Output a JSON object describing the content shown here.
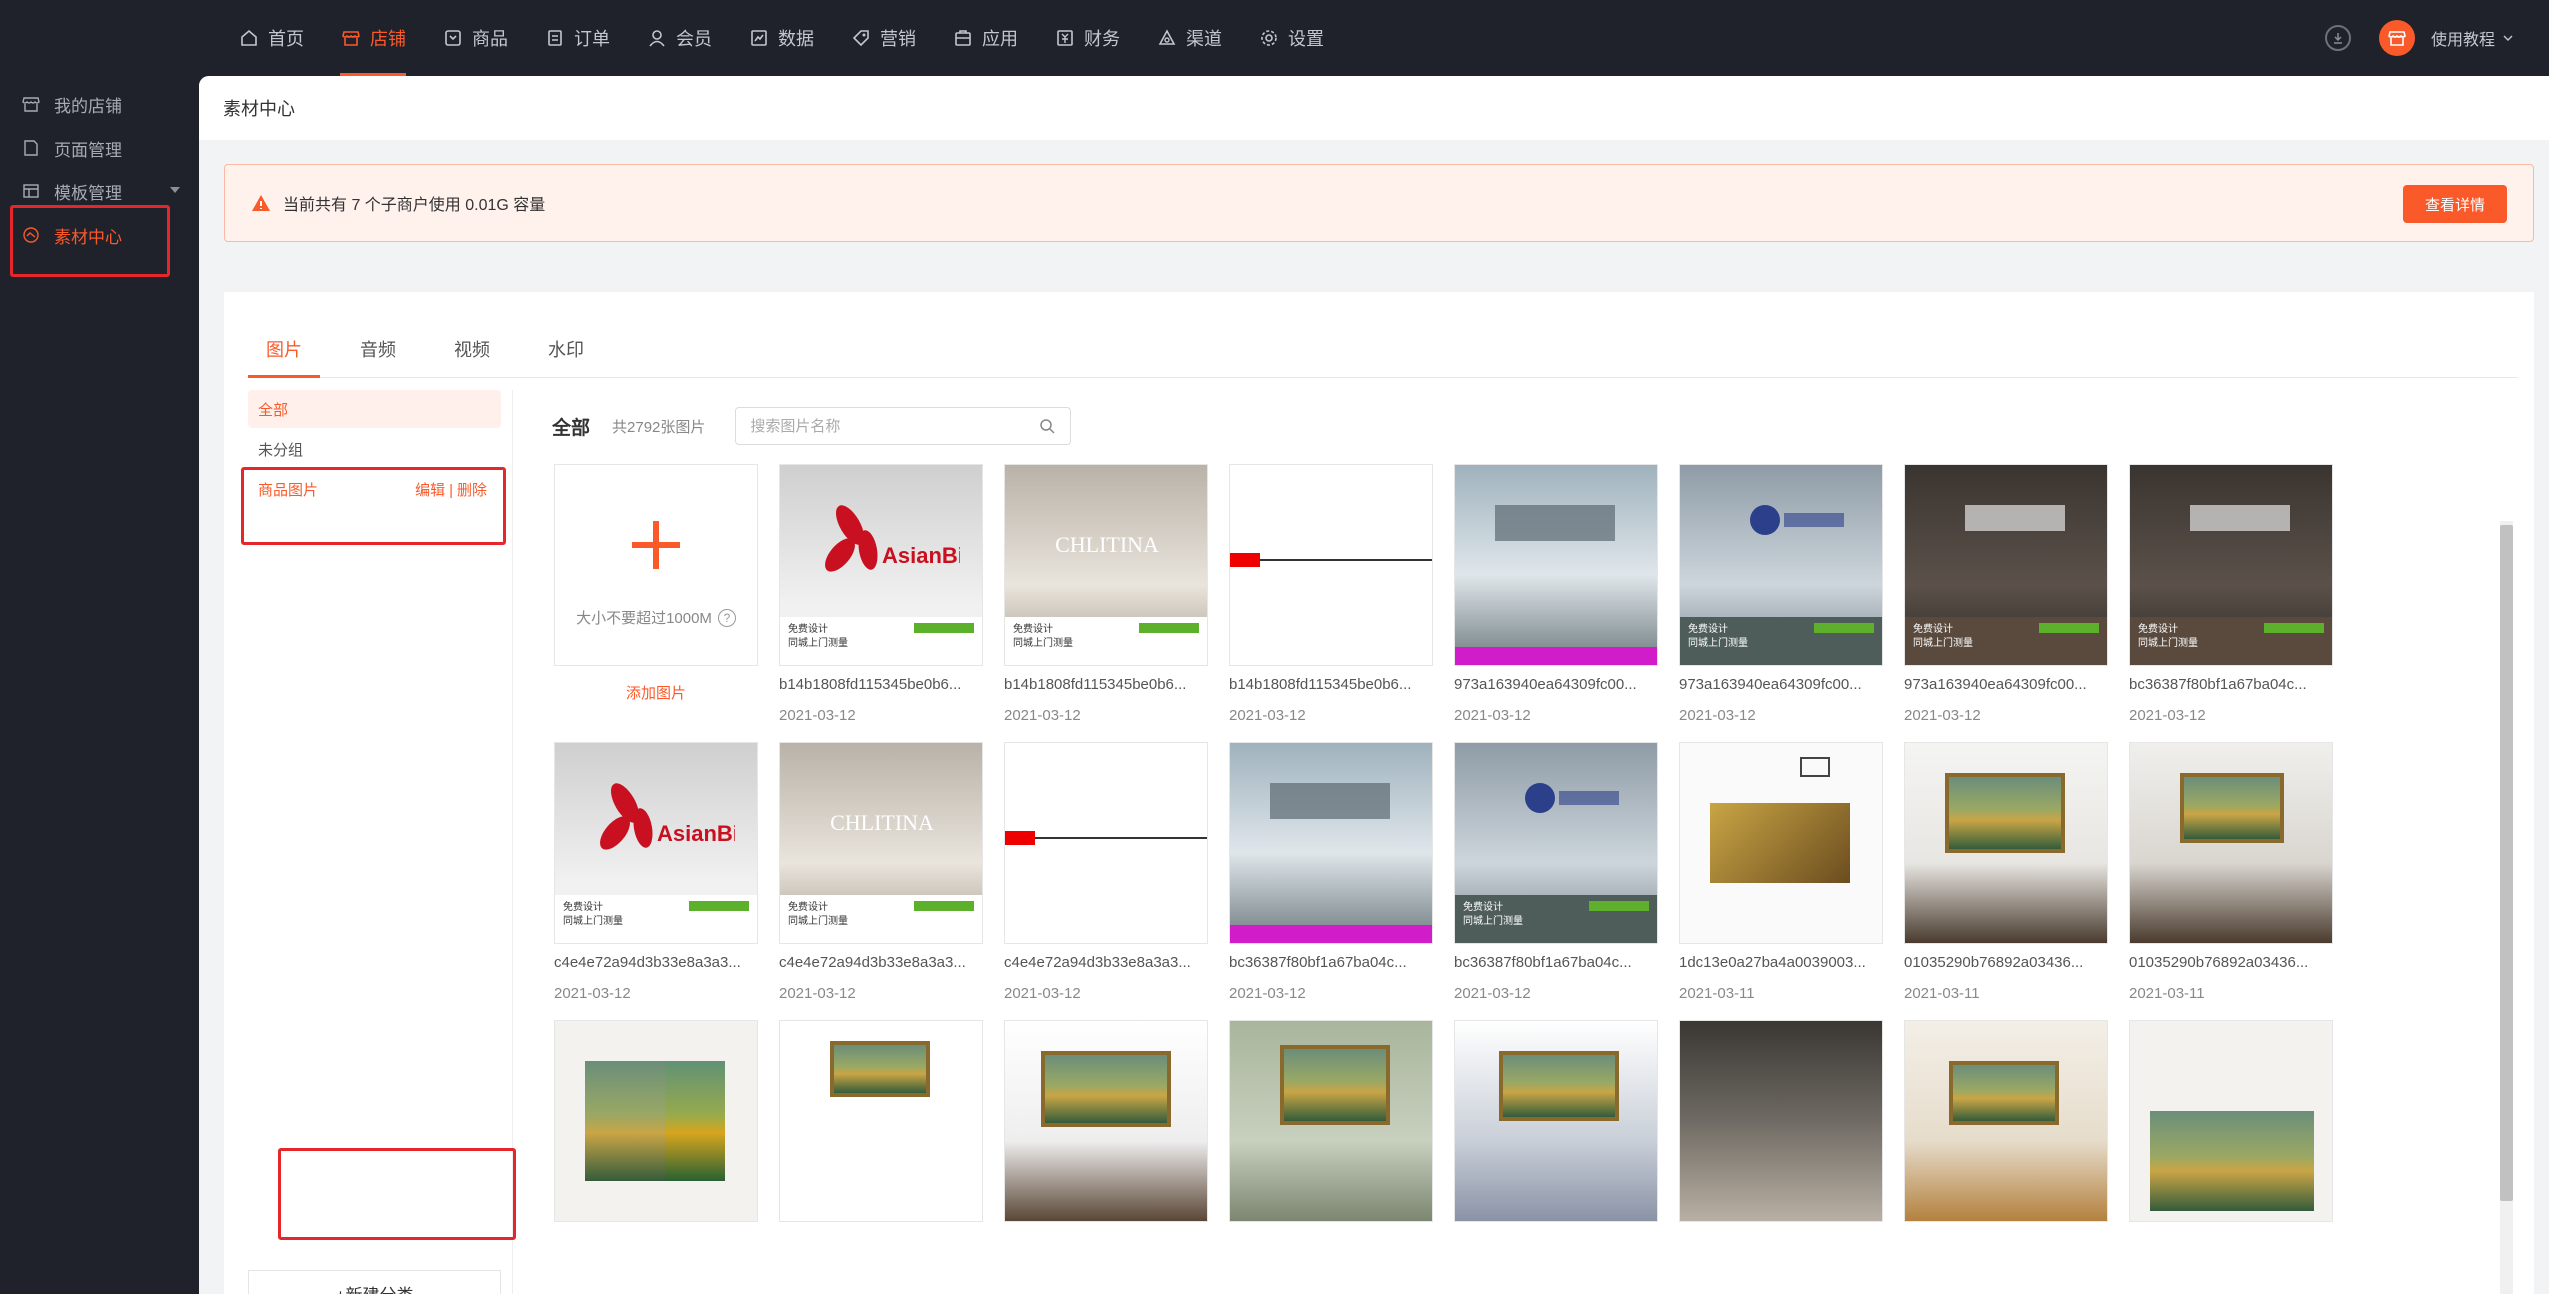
{
  "nav": {
    "items": [
      {
        "label": "首页",
        "icon": "home-icon"
      },
      {
        "label": "店铺",
        "icon": "store-icon",
        "active": true
      },
      {
        "label": "商品",
        "icon": "goods-icon"
      },
      {
        "label": "订单",
        "icon": "order-icon"
      },
      {
        "label": "会员",
        "icon": "member-icon"
      },
      {
        "label": "数据",
        "icon": "data-icon"
      },
      {
        "label": "营销",
        "icon": "marketing-icon"
      },
      {
        "label": "应用",
        "icon": "app-icon"
      },
      {
        "label": "财务",
        "icon": "finance-icon"
      },
      {
        "label": "渠道",
        "icon": "channel-icon"
      },
      {
        "label": "设置",
        "icon": "settings-icon"
      }
    ],
    "help_label": "使用教程"
  },
  "sidebar": {
    "items": [
      {
        "label": "我的店铺"
      },
      {
        "label": "页面管理"
      },
      {
        "label": "模板管理"
      },
      {
        "label": "素材中心",
        "active": true
      }
    ]
  },
  "breadcrumb": {
    "title": "素材中心"
  },
  "alert": {
    "text": "当前共有 7 个子商户使用 0.01G 容量",
    "button": "查看详情",
    "accent": "#fa5a2a"
  },
  "tabs": [
    "图片",
    "音频",
    "视频",
    "水印"
  ],
  "groups": {
    "items": [
      {
        "label": "全部"
      },
      {
        "label": "未分组"
      },
      {
        "label": "商品图片"
      }
    ],
    "edit": "编辑",
    "sep": "|",
    "delete": "删除",
    "new_category": "+新建分类"
  },
  "content": {
    "title": "全部",
    "count": "共2792张图片",
    "search_placeholder": "搜索图片名称",
    "upload_hint": "大小不要超过1000M",
    "upload_help": "?",
    "upload_add": "添加图片"
  },
  "images": [
    {
      "name": "b14b1808fd115345be0b6...",
      "date": "2021-03-12"
    },
    {
      "name": "b14b1808fd115345be0b6...",
      "date": "2021-03-12"
    },
    {
      "name": "b14b1808fd115345be0b6...",
      "date": "2021-03-12"
    },
    {
      "name": "973a163940ea64309fc00...",
      "date": "2021-03-12"
    },
    {
      "name": "973a163940ea64309fc00...",
      "date": "2021-03-12"
    },
    {
      "name": "973a163940ea64309fc00...",
      "date": "2021-03-12"
    },
    {
      "name": "bc36387f80bf1a67ba04c...",
      "date": "2021-03-12"
    },
    {
      "name": "c4e4e72a94d3b33e8a3a3...",
      "date": "2021-03-12"
    },
    {
      "name": "c4e4e72a94d3b33e8a3a3...",
      "date": "2021-03-12"
    },
    {
      "name": "c4e4e72a94d3b33e8a3a3...",
      "date": "2021-03-12"
    },
    {
      "name": "bc36387f80bf1a67ba04c...",
      "date": "2021-03-12"
    },
    {
      "name": "bc36387f80bf1a67ba04c...",
      "date": "2021-03-12"
    },
    {
      "name": "1dc13e0a27ba4a0039003...",
      "date": "2021-03-11"
    },
    {
      "name": "01035290b76892a03436...",
      "date": "2021-03-11"
    },
    {
      "name": "01035290b76892a03436...",
      "date": "2021-03-11"
    }
  ]
}
